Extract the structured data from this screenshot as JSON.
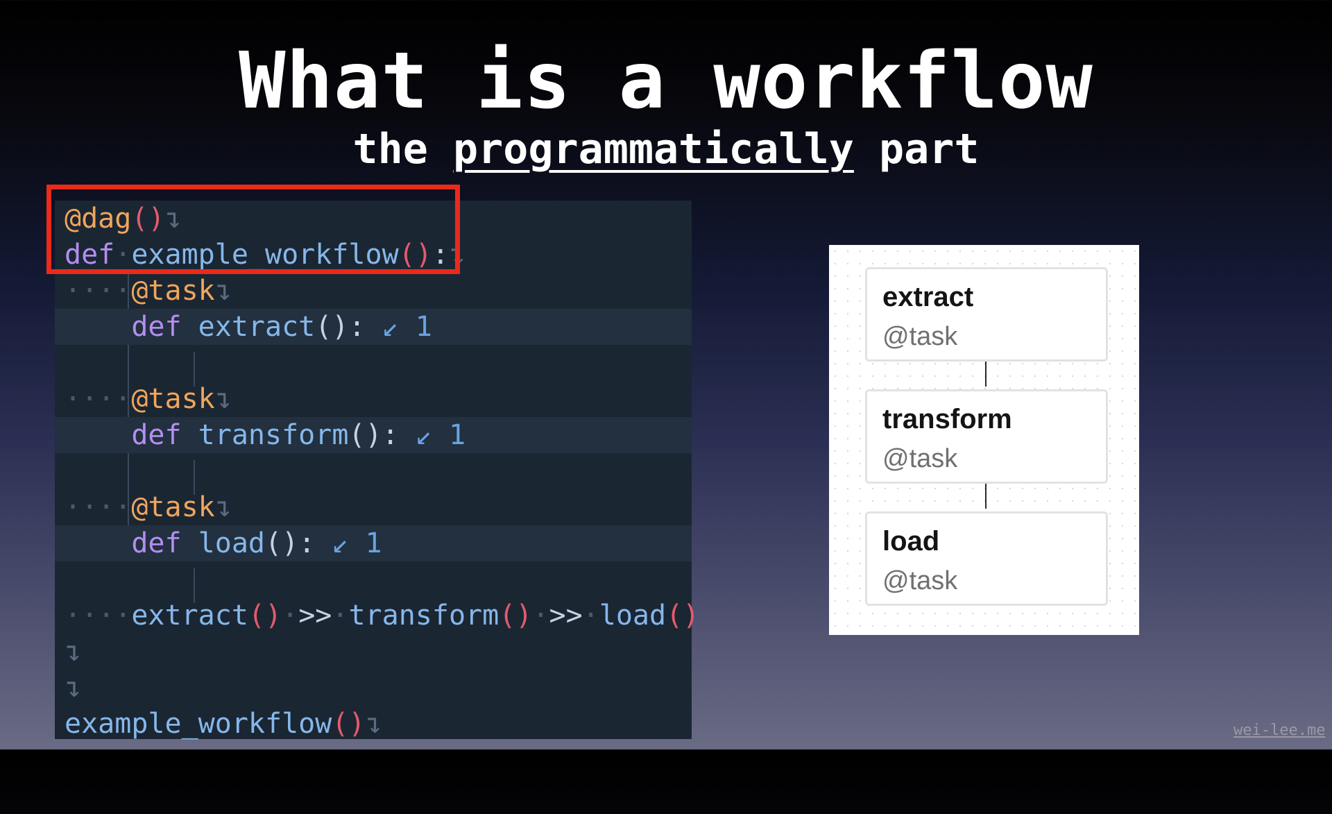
{
  "slide": {
    "title": "What is a workflow",
    "subtitle_prefix": "the",
    "subtitle_emphasis": "programmatically",
    "subtitle_suffix": "part"
  },
  "code": {
    "dag_decorator": "@dag",
    "def_kw": "def",
    "workflow_fn": "example_workflow",
    "task_decorator": "@task",
    "extract_fn": "extract",
    "transform_fn": "transform",
    "load_fn": "load",
    "open_paren": "(",
    "close_paren": ")",
    "colon": ":",
    "chain_op": ">>",
    "newline_mark": "↴",
    "fold_badge": "↙ 1"
  },
  "dag": {
    "nodes": [
      {
        "name": "extract",
        "type": "@task"
      },
      {
        "name": "transform",
        "type": "@task"
      },
      {
        "name": "load",
        "type": "@task"
      }
    ]
  },
  "watermark": "wei-lee.me",
  "colors": {
    "highlight_border": "#ea2a1b",
    "code_background": "#1b2633",
    "decorator": "#f0a55c",
    "keyword": "#b48ef0",
    "function": "#86b7ea",
    "paren": "#e35b6e"
  }
}
